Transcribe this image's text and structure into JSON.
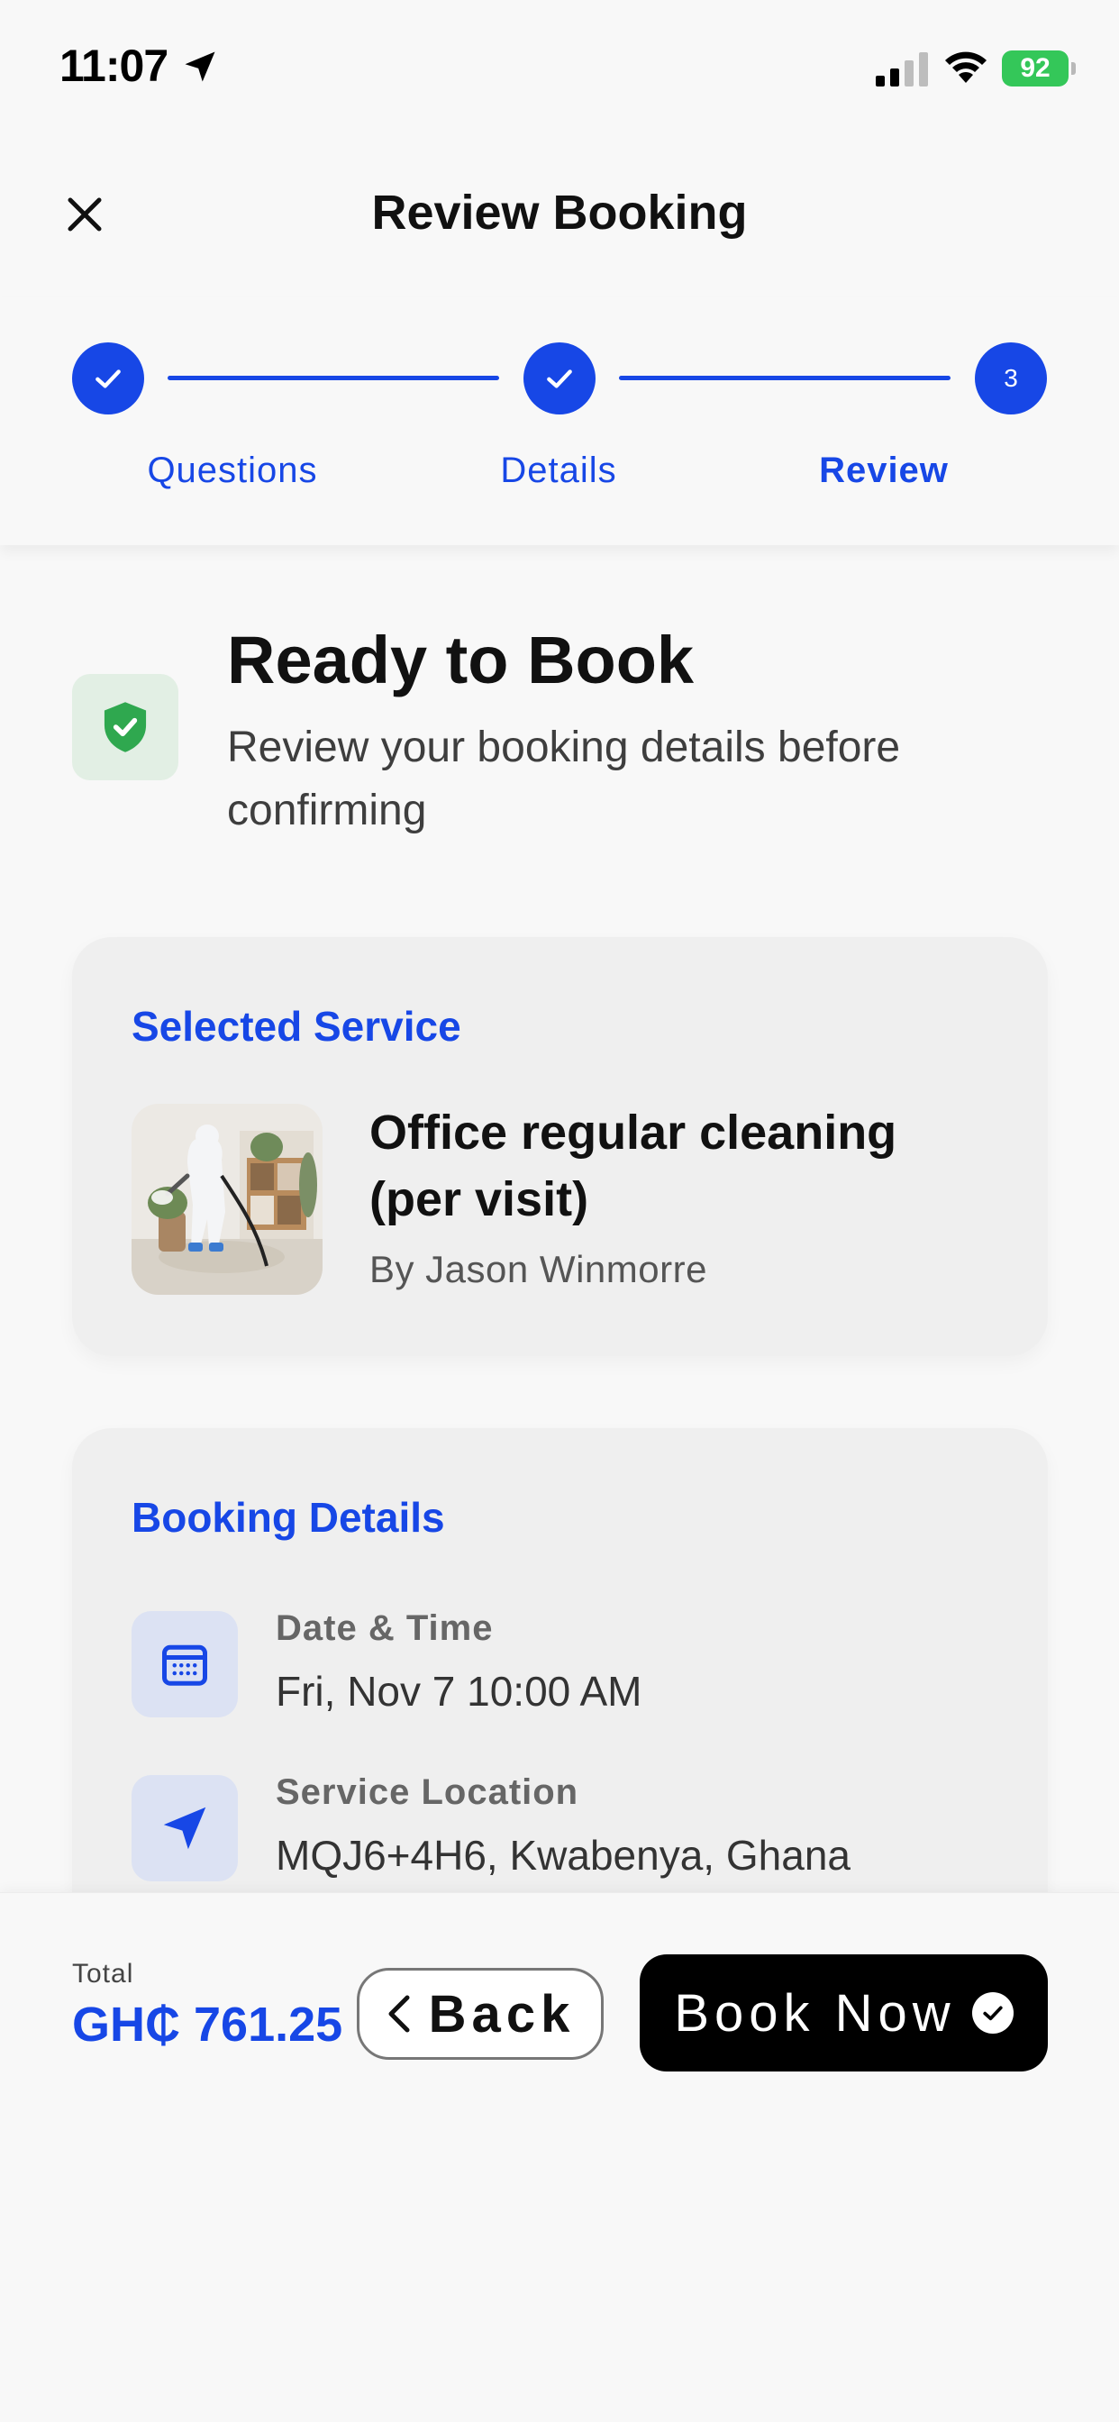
{
  "status_bar": {
    "time": "11:07",
    "battery": "92"
  },
  "header": {
    "title": "Review Booking",
    "close_icon": "close-icon"
  },
  "stepper": {
    "steps": [
      {
        "label": "Questions",
        "state": "completed",
        "marker": "check-icon"
      },
      {
        "label": "Details",
        "state": "completed",
        "marker": "check-icon"
      },
      {
        "label": "Review",
        "state": "active",
        "marker": "3"
      }
    ]
  },
  "ready": {
    "title": "Ready to Book",
    "subtitle": "Review your booking details before confirming",
    "icon": "shield-check-icon"
  },
  "selected_service": {
    "heading": "Selected Service",
    "name": "Office regular cleaning (per visit)",
    "provider": "By Jason Winmorre"
  },
  "booking_details": {
    "heading": "Booking Details",
    "items": [
      {
        "label": "Date & Time",
        "value": "Fri, Nov 7 10:00 AM",
        "icon": "calendar-icon"
      },
      {
        "label": "Service Location",
        "value": "MQJ6+4H6, Kwabenya, Ghana",
        "icon": "location-arrow-icon"
      }
    ]
  },
  "footer": {
    "total_label": "Total",
    "total_value": "GH₵ 761.25",
    "back_label": "Back",
    "book_label": "Book Now"
  },
  "colors": {
    "accent": "#1747e6",
    "success": "#34c759",
    "shield_green": "#2fa84f",
    "background": "#f8f8f8",
    "card": "#efefef",
    "button_dark": "#000000"
  }
}
